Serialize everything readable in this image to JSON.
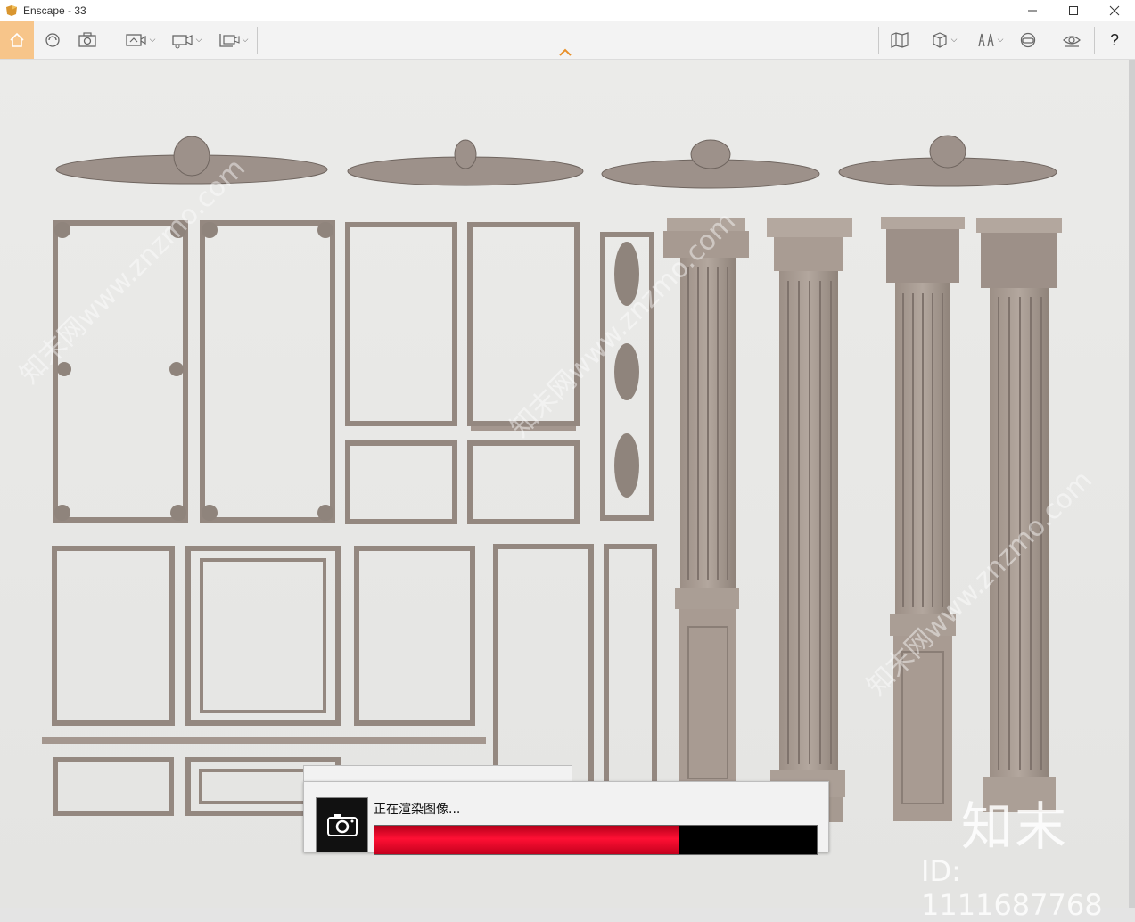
{
  "window": {
    "title": "Enscape - 33",
    "controls": [
      "minimize-icon",
      "maximize-icon",
      "close-icon"
    ]
  },
  "toolbar": {
    "left_tools": [
      "home-icon",
      "orbit-icon",
      "capture-screenshot-icon",
      "render-view-icon",
      "video-editor-icon",
      "batch-render-icon"
    ],
    "right_tools": [
      "map-icon",
      "cube-view-icon",
      "asset-library-icon",
      "vr-headset-icon",
      "visual-settings-icon"
    ],
    "help_label": "?",
    "accent_color": "#f7c58a"
  },
  "render_dialog": {
    "status_text": "正在渲染图像...",
    "progress": 0.69,
    "bar_fill_color": "#ff1034",
    "bar_background_color": "#000000"
  },
  "watermark": {
    "brand": "知末",
    "id_text": "ID: 1111687768",
    "site_text": "知末网www.znzmo.com"
  }
}
